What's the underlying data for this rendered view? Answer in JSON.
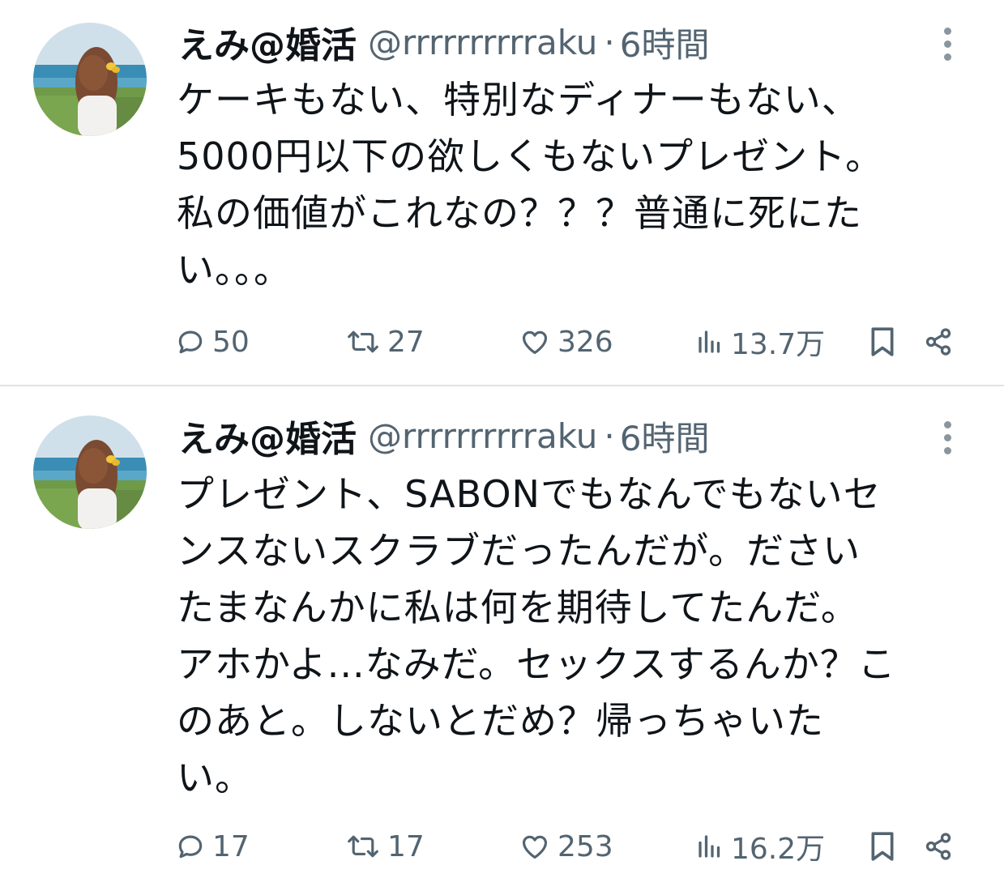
{
  "tweets": [
    {
      "display_name": "えみ@婚活",
      "handle": "@rrrrrrrrrraku",
      "separator": "·",
      "time": "6時間",
      "text": "ケーキもない、特別なディナーもない、\n5000円以下の欲しくもないプレゼント。\n私の価値がこれなの？？？普通に死にた\nい。。。",
      "replies": "50",
      "retweets": "27",
      "likes": "326",
      "views": "13.7万"
    },
    {
      "display_name": "えみ@婚活",
      "handle": "@rrrrrrrrrraku",
      "separator": "·",
      "time": "6時間",
      "text": "プレゼント、SABONでもなんでもないセ\nンスないスクラブだったんだが。ださい\nたまなんかに私は何を期待してたんだ。\nアホかよ...なみだ。セックスするんか？こ\nのあと。しないとだめ？帰っちゃいた\nい。",
      "replies": "17",
      "retweets": "17",
      "likes": "253",
      "views": "16.2万"
    }
  ],
  "icons": {
    "reply": "reply-icon",
    "retweet": "retweet-icon",
    "like": "heart-icon",
    "views": "views-icon",
    "bookmark": "bookmark-icon",
    "share": "share-icon",
    "more": "more-vertical-icon"
  },
  "colors": {
    "text": "#0f1419",
    "secondary": "#536471",
    "divider": "#dfe3e6"
  }
}
